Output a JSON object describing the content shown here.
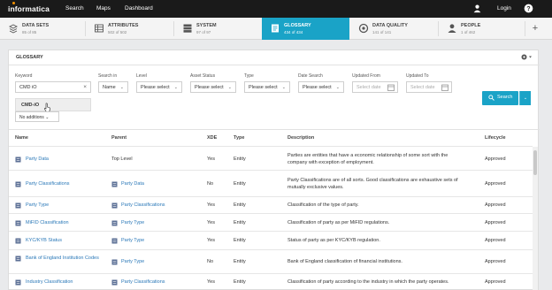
{
  "app": {
    "logo": "informatica"
  },
  "topnav": {
    "search": "Search",
    "maps": "Maps",
    "dashboard": "Dashboard",
    "login": "Login",
    "help": "?"
  },
  "tabs": [
    {
      "name": "DATA SETS",
      "count": "85 of 85",
      "icon": "data-sets-icon"
    },
    {
      "name": "ATTRIBUTES",
      "count": "502 of 502",
      "icon": "attributes-icon"
    },
    {
      "name": "SYSTEM",
      "count": "97 of 97",
      "icon": "system-icon"
    },
    {
      "name": "GLOSSARY",
      "count": "434 of 434",
      "icon": "glossary-icon",
      "active": true
    },
    {
      "name": "DATA QUALITY",
      "count": "141 of 141",
      "icon": "data-quality-icon"
    },
    {
      "name": "PEOPLE",
      "count": "1 of 462",
      "icon": "people-icon"
    }
  ],
  "panel": {
    "title": "GLOSSARY"
  },
  "filters": {
    "keyword": {
      "label": "Keyword",
      "value": "CMD iO"
    },
    "search_in": {
      "label": "Search in",
      "value": "Name"
    },
    "level": {
      "label": "Level",
      "value": "Please select"
    },
    "asset_status": {
      "label": "Asset Status",
      "value": "Please select"
    },
    "type": {
      "label": "Type",
      "value": "Please select"
    },
    "date_search": {
      "label": "Date Search",
      "value": "Please select"
    },
    "updated_from": {
      "label": "Updated From",
      "placeholder": "Select date"
    },
    "updated_to": {
      "label": "Updated To",
      "placeholder": "Select date"
    },
    "suggestion": "CMD-iO",
    "additions": "No additions"
  },
  "search_button": "Search",
  "table": {
    "headers": {
      "name": "Name",
      "parent": "Parent",
      "xde": "XDE",
      "type": "Type",
      "description": "Description",
      "lifecycle": "Lifecycle"
    },
    "rows": [
      {
        "name": "Party Data",
        "parent": "Top Level",
        "parent_link": false,
        "xde": "Yes",
        "type": "Entity",
        "description": "Parties are entities that have a economic relationship of some sort with the company with exception of employment.",
        "lifecycle": "Approved"
      },
      {
        "name": "Party Classifications",
        "parent": "Party Data",
        "parent_link": true,
        "xde": "No",
        "type": "Entity",
        "description": "Party Classifications are of all sorts. Good classifications are exhaustive sets of mutually exclusive values.",
        "lifecycle": "Approved"
      },
      {
        "name": "Party Type",
        "parent": "Party Classifications",
        "parent_link": true,
        "xde": "Yes",
        "type": "Entity",
        "description": "Classification of the type of party.",
        "lifecycle": "Approved"
      },
      {
        "name": "MiFID Classification",
        "parent": "Party Type",
        "parent_link": true,
        "xde": "Yes",
        "type": "Entity",
        "description": "Classification of party as per MiFID regulations.",
        "lifecycle": "Approved"
      },
      {
        "name": "KYC/KYB Status",
        "parent": "Party Type",
        "parent_link": true,
        "xde": "Yes",
        "type": "Entity",
        "description": "Status of party as per KYC/KYB regulation.",
        "lifecycle": "Approved"
      },
      {
        "name": "Bank of England Institution Codes",
        "parent": "Party Type",
        "parent_link": true,
        "xde": "No",
        "type": "Entity",
        "description": "Bank of England classification of financial institutions.",
        "lifecycle": "Approved"
      },
      {
        "name": "Industry Classification",
        "parent": "Party Classifications",
        "parent_link": true,
        "xde": "Yes",
        "type": "Entity",
        "description": "Classification of party according to the industry in which the party operates.",
        "lifecycle": "Approved"
      }
    ]
  },
  "colors": {
    "accent": "#1aa3c7",
    "topbar": "#1a1a1a",
    "link": "#2a78b8",
    "logo_dot": "#f39200"
  }
}
